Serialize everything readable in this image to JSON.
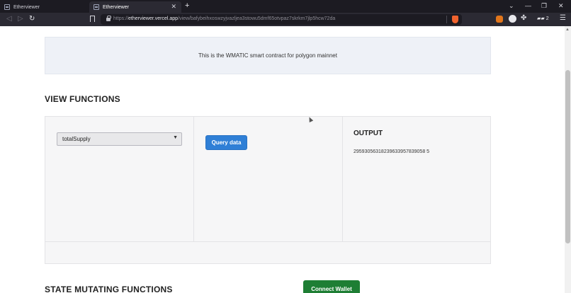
{
  "browser": {
    "tabs": [
      {
        "title": "Etherviewer",
        "active": false
      },
      {
        "title": "Etherviewer",
        "active": true
      }
    ],
    "new_tab_icon": "plus-icon",
    "window_controls": [
      "chevron-down-icon",
      "minimize-icon",
      "restore-icon",
      "close-icon"
    ],
    "window_control_glyphs": [
      "⌄",
      "—",
      "❐",
      "✕"
    ],
    "url": {
      "prefix": "https://",
      "host": "etherviewer.vercel.app",
      "path": "/view/bafybeihxoswzyjvazljea3stowu5dmf65otvpaz7skrkm7jlp5hcw72da"
    },
    "wallet_badge": "2"
  },
  "page": {
    "info_text": "This is the WMATIC smart contract for polygon mainnet",
    "view_functions_title": "VIEW FUNCTIONS",
    "function_select": {
      "selected": "totalSupply"
    },
    "query_button": "Query data",
    "output_title": "OUTPUT",
    "output_value": "29593056318239633957839058 5",
    "state_functions_title": "STATE MUTATING FUNCTIONS",
    "connect_button": "Connect Wallet"
  },
  "colors": {
    "tabbar": "#1c1b22",
    "toolbar": "#2b2a33",
    "info_box": "#eef1f7",
    "query_button": "#2f7fd6",
    "connect_button": "#1e7e34"
  }
}
